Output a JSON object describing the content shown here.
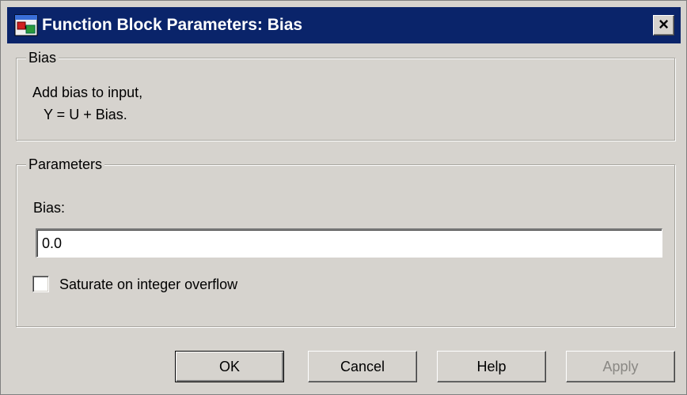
{
  "window": {
    "title": "Function Block Parameters: Bias",
    "close_glyph": "×",
    "icon": "simulink-block-icon",
    "close_icon": "close-icon"
  },
  "description_group": {
    "legend": "Bias",
    "line1": "Add bias to input,",
    "line2": "Y = U + Bias."
  },
  "parameters_group": {
    "legend": "Parameters",
    "bias_label": "Bias:",
    "bias_value": "0.0",
    "saturate_label": "Saturate on integer overflow",
    "saturate_checked": false
  },
  "buttons": {
    "ok": "OK",
    "cancel": "Cancel",
    "help": "Help",
    "apply": "Apply",
    "apply_enabled": false
  },
  "colors": {
    "titlebar": "#0a246a",
    "dialog_bg": "#d6d3ce",
    "disabled_text": "#8a8884"
  }
}
